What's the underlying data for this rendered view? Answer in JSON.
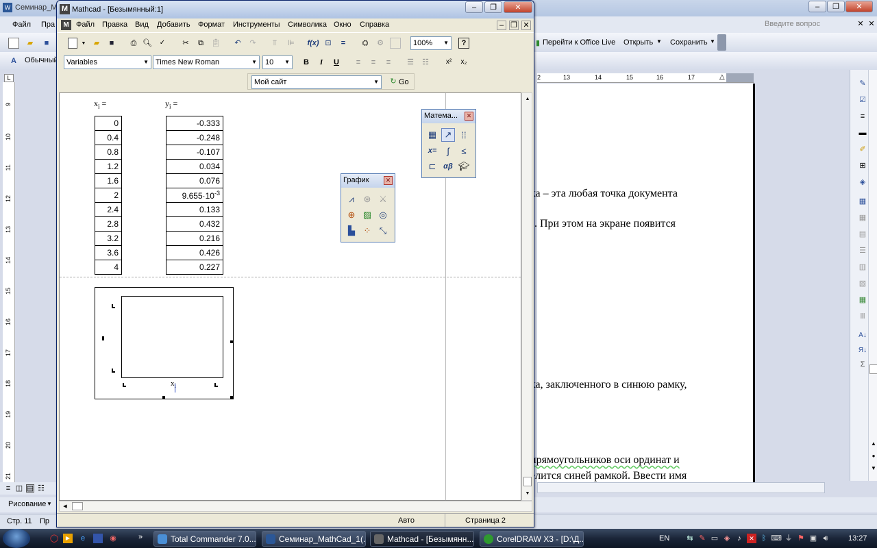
{
  "word": {
    "title": "Семинар_Ма",
    "menu": [
      "Файл",
      "Пра"
    ],
    "ask_placeholder": "Введите вопрос",
    "office_live": "Перейти к Office Live",
    "open": "Открыть",
    "save": "Сохранить",
    "style": "Обычный",
    "ruler_numbers": [
      "2",
      "13",
      "14",
      "15",
      "16",
      "17"
    ],
    "vruler_numbers": [
      "9",
      "10",
      "11",
      "12",
      "13",
      "14",
      "15",
      "16",
      "17",
      "18",
      "19",
      "20",
      "21"
    ],
    "text_lines": [
      "ка  –  эта  любая  точка  документа",
      ".  При  этом  на  экране  появится",
      "ка, заключенного в синюю рамку,",
      "прямоугольников  оси  ординат  и",
      "елится синей рамкой. Ввести имя"
    ],
    "drawing": "Рисование",
    "status_page": "Стр. 11",
    "status_col": "Пр"
  },
  "mathcad": {
    "title": "Mathcad - [Безымянный:1]",
    "menu": [
      "Файл",
      "Правка",
      "Вид",
      "Добавить",
      "Формат",
      "Инструменты",
      "Символика",
      "Окно",
      "Справка"
    ],
    "zoom": "100%",
    "style_combo": "Variables",
    "font_combo": "Times New Roman",
    "size_combo": "10",
    "url_combo": "Мой сайт",
    "go": "Go",
    "x_label": "x",
    "x_sub": "i",
    "y_label": "y",
    "y_sub": "i",
    "eq": " =",
    "x_values": [
      "0",
      "0.4",
      "0.8",
      "1.2",
      "1.6",
      "2",
      "2.4",
      "2.8",
      "3.2",
      "3.6",
      "4"
    ],
    "y_values": [
      "-0.333",
      "-0.248",
      "-0.107",
      "0.034",
      "0.076",
      "9.655·10",
      "0.133",
      "0.432",
      "0.216",
      "0.426",
      "0.227"
    ],
    "y_exp": "-3",
    "plot_xlabel": "x",
    "plot_xsub": "i",
    "status_mode": "Авто",
    "status_page": "Страница 2",
    "palette_math": "Матема...",
    "palette_graph": "График"
  },
  "taskbar": {
    "items": [
      "Total Commander 7.0...",
      "Семинар_MathCad_1(...",
      "Mathcad - [Безымянн...",
      "CorelDRAW X3 - [D:\\Д..."
    ],
    "lang": "EN",
    "clock": "13:27"
  }
}
